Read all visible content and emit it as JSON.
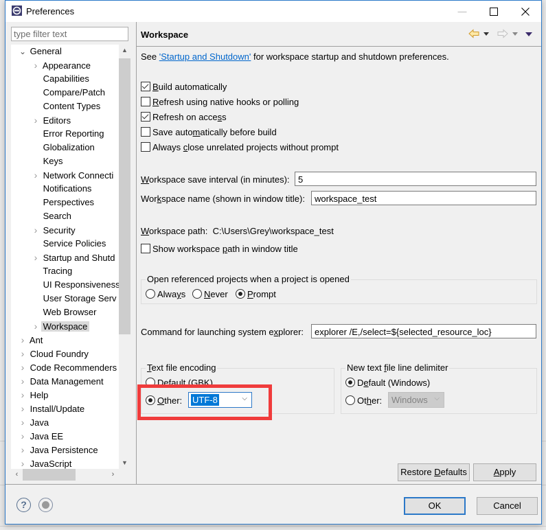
{
  "window": {
    "title": "Preferences",
    "controls": {
      "minimize": "—",
      "maximize": "☐",
      "close": "✕"
    }
  },
  "sidebar": {
    "filter_placeholder": "type filter text",
    "tree": [
      {
        "label": "General",
        "level": 0,
        "toggle": "expanded"
      },
      {
        "label": "Appearance",
        "level": 1,
        "toggle": "collapsed"
      },
      {
        "label": "Capabilities",
        "level": 1,
        "toggle": "none"
      },
      {
        "label": "Compare/Patch",
        "level": 1,
        "toggle": "none"
      },
      {
        "label": "Content Types",
        "level": 1,
        "toggle": "none"
      },
      {
        "label": "Editors",
        "level": 1,
        "toggle": "collapsed"
      },
      {
        "label": "Error Reporting",
        "level": 1,
        "toggle": "none"
      },
      {
        "label": "Globalization",
        "level": 1,
        "toggle": "none"
      },
      {
        "label": "Keys",
        "level": 1,
        "toggle": "none"
      },
      {
        "label": "Network Connecti",
        "level": 1,
        "toggle": "collapsed"
      },
      {
        "label": "Notifications",
        "level": 1,
        "toggle": "none"
      },
      {
        "label": "Perspectives",
        "level": 1,
        "toggle": "none"
      },
      {
        "label": "Search",
        "level": 1,
        "toggle": "none"
      },
      {
        "label": "Security",
        "level": 1,
        "toggle": "collapsed"
      },
      {
        "label": "Service Policies",
        "level": 1,
        "toggle": "none"
      },
      {
        "label": "Startup and Shutd",
        "level": 1,
        "toggle": "collapsed"
      },
      {
        "label": "Tracing",
        "level": 1,
        "toggle": "none"
      },
      {
        "label": "UI Responsiveness",
        "level": 1,
        "toggle": "none"
      },
      {
        "label": "User Storage Serv",
        "level": 1,
        "toggle": "none"
      },
      {
        "label": "Web Browser",
        "level": 1,
        "toggle": "none"
      },
      {
        "label": "Workspace",
        "level": 1,
        "toggle": "collapsed",
        "selected": true
      },
      {
        "label": "Ant",
        "level": 0,
        "toggle": "collapsed"
      },
      {
        "label": "Cloud Foundry",
        "level": 0,
        "toggle": "collapsed"
      },
      {
        "label": "Code Recommenders",
        "level": 0,
        "toggle": "collapsed"
      },
      {
        "label": "Data Management",
        "level": 0,
        "toggle": "collapsed"
      },
      {
        "label": "Help",
        "level": 0,
        "toggle": "collapsed"
      },
      {
        "label": "Install/Update",
        "level": 0,
        "toggle": "collapsed"
      },
      {
        "label": "Java",
        "level": 0,
        "toggle": "collapsed"
      },
      {
        "label": "Java EE",
        "level": 0,
        "toggle": "collapsed"
      },
      {
        "label": "Java Persistence",
        "level": 0,
        "toggle": "collapsed"
      },
      {
        "label": "JavaScript",
        "level": 0,
        "toggle": "collapsed"
      }
    ]
  },
  "page": {
    "title": "Workspace",
    "intro_prefix": "See ",
    "intro_link": "'Startup and Shutdown'",
    "intro_suffix": " for workspace startup and shutdown preferences.",
    "checkboxes": [
      {
        "mn": "B",
        "rest": "uild automatically",
        "pre": "",
        "checked": true
      },
      {
        "mn": "R",
        "rest": "efresh using native hooks or polling",
        "pre": "",
        "checked": false
      },
      {
        "pre": "Refresh on acce",
        "mn": "s",
        "rest": "s",
        "checked": true
      },
      {
        "pre": "Save auto",
        "mn": "m",
        "rest": "atically before build",
        "checked": false
      },
      {
        "pre": "Always ",
        "mn": "c",
        "rest": "lose unrelated projects without prompt",
        "checked": false
      }
    ],
    "save_interval": {
      "pre": "",
      "mn": "W",
      "rest": "orkspace save interval (in minutes):",
      "value": "5"
    },
    "workspace_name": {
      "pre": "Wor",
      "mn": "k",
      "rest": "space name (shown in window title):",
      "value": "workspace_test"
    },
    "workspace_path": {
      "mn": "W",
      "rest": "orkspace path:",
      "value": "C:\\Users\\Grey\\workspace_test"
    },
    "show_path": {
      "pre": "Show workspace ",
      "mn": "p",
      "rest": "ath in window title",
      "checked": false
    },
    "open_ref_group": {
      "title": "Open referenced projects when a project is opened",
      "options": [
        {
          "pre": "Alwa",
          "mn": "y",
          "rest": "s",
          "selected": false
        },
        {
          "pre": "",
          "mn": "N",
          "rest": "ever",
          "selected": false
        },
        {
          "pre": "",
          "mn": "P",
          "rest": "rompt",
          "selected": true
        }
      ]
    },
    "explorer_cmd": {
      "pre": "Command for launching system e",
      "mn": "x",
      "rest": "plorer:",
      "value": "explorer /E,/select=${selected_resource_loc}"
    },
    "encoding_group": {
      "title_mn": "T",
      "title_rest": "ext file encoding",
      "default_label": "Default (GBK)",
      "default_selected": false,
      "other_mn": "O",
      "other_rest": "ther:",
      "other_selected": true,
      "other_value": "UTF-8"
    },
    "delimiter_group": {
      "title_pre": "New text ",
      "title_mn": "f",
      "title_rest": "ile line delimiter",
      "default_pre": "D",
      "default_mn": "e",
      "default_rest": "fault (Windows)",
      "default_selected": true,
      "other_pre": "Ot",
      "other_mn": "h",
      "other_rest": "er:",
      "other_selected": false,
      "other_value": "Windows"
    },
    "restore_defaults": {
      "pre": "Restore ",
      "mn": "D",
      "rest": "efaults"
    },
    "apply": {
      "pre": "",
      "mn": "A",
      "rest": "pply"
    }
  },
  "footer": {
    "ok": "OK",
    "cancel": "Cancel"
  },
  "colors": {
    "accent": "#2b78c8",
    "link": "#0066cc",
    "highlight_box": "#f03c3c",
    "selection": "#0078d7"
  }
}
